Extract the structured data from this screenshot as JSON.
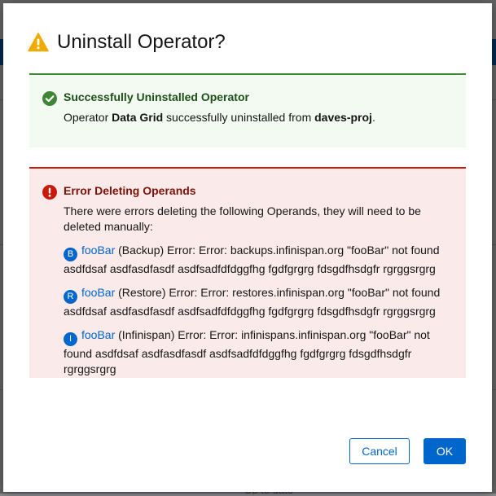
{
  "background": {
    "footer_text": "Up to date"
  },
  "modal": {
    "title": "Uninstall Operator?",
    "success_alert": {
      "title": "Successfully Uninstalled Operator",
      "text_prefix": "Operator ",
      "operator_name": "Data Grid",
      "text_middle": " successfully uninstalled from ",
      "namespace": "daves-proj",
      "text_suffix": "."
    },
    "error_alert": {
      "title": "Error Deleting Operands",
      "description": "There were errors deleting the following Operands, they will need to be deleted manually:",
      "operands": [
        {
          "badge": "B",
          "name": "fooBar",
          "message": " (Backup) Error: Error: backups.infinispan.org \"fooBar\" not found asdfdsaf asdfasdfasdf asdfsadfdfdggfhg fgdfgrgrg fdsgdfhsdgfr rgrggsrgrg"
        },
        {
          "badge": "R",
          "name": "fooBar",
          "message": " (Restore) Error: Error: restores.infinispan.org \"fooBar\" not found asdfdsaf asdfasdfasdf asdfsadfdfdggfhg fgdfgrgrg fdsgdfhsdgfr rgrggsrgrg"
        },
        {
          "badge": "I",
          "name": "fooBar",
          "message": " (Infinispan) Error: Error: infinispans.infinispan.org \"fooBar\" not found asdfdsaf asdfasdfasdf asdfsadfdfdggfhg fgdfgrgrg fdsgdfhsdgfr rgrggsrgrg"
        }
      ]
    },
    "buttons": {
      "cancel": "Cancel",
      "ok": "OK"
    }
  },
  "colors": {
    "primary": "#0066cc",
    "success": "#3e8635",
    "danger": "#c9190b",
    "warning": "#f0ab00"
  },
  "icons": {
    "title": "warning-triangle-icon",
    "success": "check-circle-icon",
    "error": "exclamation-circle-icon"
  }
}
